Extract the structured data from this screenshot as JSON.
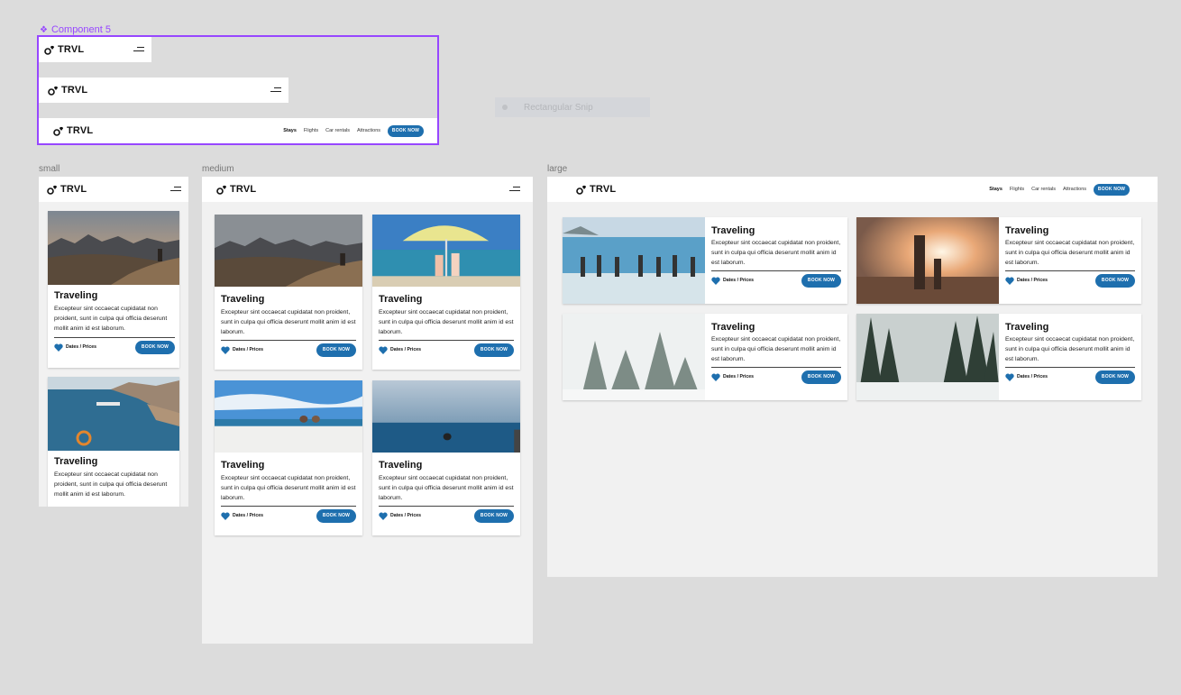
{
  "component": {
    "label": "Component 5",
    "icon": "component-diamond-icon"
  },
  "brand": {
    "name": "TRVL",
    "icon": "map-pin-heart-icon"
  },
  "nav": {
    "links": [
      "Stays",
      "Flights",
      "Car rentals",
      "Attractions"
    ],
    "active": "Stays",
    "cta": "BOOK NOW"
  },
  "overlay": {
    "label": "Rectangular Snip"
  },
  "frames": {
    "small": "small",
    "medium": "medium",
    "large": "large"
  },
  "card": {
    "title": "Traveling",
    "description": "Excepteur sint occaecat cupidatat non proident, sunt in culpa qui officia deserunt mollit anim id est laborum.",
    "dates_label": "Dates / Prices",
    "cta": "BOOK NOW"
  },
  "colors": {
    "accent": "#1e6fae",
    "component_outline": "#9747ff",
    "canvas": "#dcdcdc",
    "frame_bg": "#f1f1f1"
  }
}
